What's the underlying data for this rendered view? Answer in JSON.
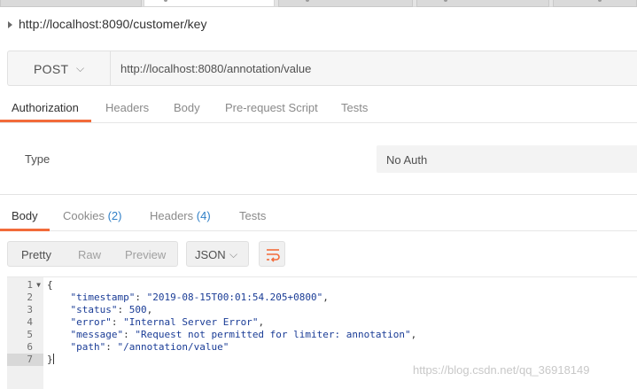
{
  "request": {
    "title": "http://localhost:8090/customer/key",
    "method": "POST",
    "url": "http://localhost:8080/annotation/value"
  },
  "request_tabs": [
    {
      "label": "Authorization",
      "active": true
    },
    {
      "label": "Headers",
      "active": false
    },
    {
      "label": "Body",
      "active": false
    },
    {
      "label": "Pre-request Script",
      "active": false
    },
    {
      "label": "Tests",
      "active": false
    }
  ],
  "auth": {
    "type_label": "Type",
    "selected": "No Auth"
  },
  "response_tabs": [
    {
      "label": "Body",
      "count": "",
      "active": true
    },
    {
      "label": "Cookies",
      "count": "(2)",
      "active": false
    },
    {
      "label": "Headers",
      "count": "(4)",
      "active": false
    },
    {
      "label": "Tests",
      "count": "",
      "active": false
    }
  ],
  "view_modes": [
    "Pretty",
    "Raw",
    "Preview"
  ],
  "active_view": "Pretty",
  "format": "JSON",
  "response_json": {
    "timestamp": "2019-08-15T00:01:54.205+0800",
    "status": "500",
    "error": "Internal Server Error",
    "message": "Request not permitted for limiter: annotation",
    "path": "/annotation/value"
  },
  "line_numbers": [
    "1",
    "2",
    "3",
    "4",
    "5",
    "6",
    "7"
  ],
  "watermark": "https://blog.csdn.net/qq_36918149",
  "colors": {
    "accent": "#f26b3a",
    "count_blue": "#2f7fc7",
    "json_blue": "#1a3c96"
  }
}
